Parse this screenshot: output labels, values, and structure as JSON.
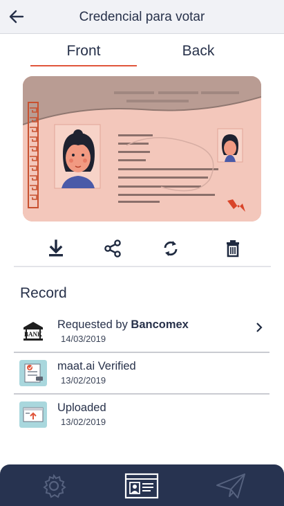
{
  "header": {
    "title": "Credencial para votar",
    "back_icon": "arrow-left-icon"
  },
  "tabs": [
    {
      "label": "Front",
      "active": true
    },
    {
      "label": "Back",
      "active": false
    }
  ],
  "colors": {
    "accent": "#e0553a",
    "text": "#27314a",
    "nav_background": "#273350",
    "card_background": "#f3c7bb"
  },
  "actions": [
    {
      "icon": "download-icon"
    },
    {
      "icon": "share-icon"
    },
    {
      "icon": "refresh-icon"
    },
    {
      "icon": "trash-icon"
    }
  ],
  "record": {
    "title": "Record",
    "items": [
      {
        "prefix": "Requested by ",
        "bold": "Bancomex",
        "date": "14/03/2019",
        "icon": "bank-icon",
        "icon_text": "BANK"
      },
      {
        "prefix": "maat.ai Verified",
        "bold": "",
        "date": "13/02/2019",
        "icon": "verified-document-icon"
      },
      {
        "prefix": "Uploaded",
        "bold": "",
        "date": "13/02/2019",
        "icon": "upload-icon"
      }
    ]
  },
  "bottom_nav": [
    {
      "icon": "gear-icon",
      "active": false
    },
    {
      "icon": "id-card-icon",
      "active": true
    },
    {
      "icon": "paper-plane-icon",
      "active": false
    }
  ]
}
